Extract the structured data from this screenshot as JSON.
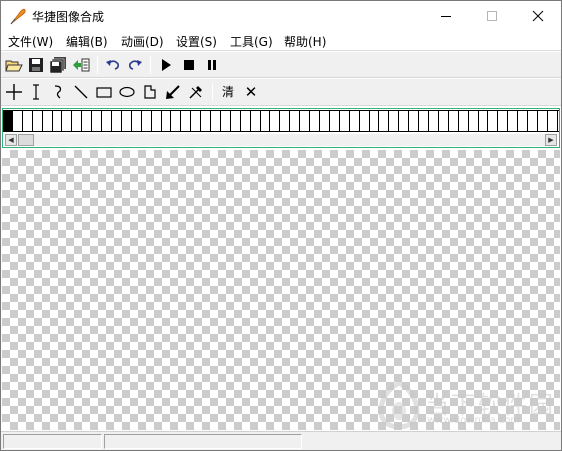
{
  "window": {
    "title": "华捷图像合成",
    "controls": {
      "minimize": "minimize",
      "maximize": "maximize",
      "close": "close"
    }
  },
  "menu": [
    {
      "label": "文件(W)"
    },
    {
      "label": "编辑(B)"
    },
    {
      "label": "动画(D)"
    },
    {
      "label": "设置(S)"
    },
    {
      "label": "工具(G)"
    },
    {
      "label": "帮助(H)"
    }
  ],
  "toolbar1": [
    {
      "name": "open-icon"
    },
    {
      "name": "save-icon"
    },
    {
      "name": "save-all-icon"
    },
    {
      "name": "import-icon"
    },
    {
      "name": "undo-icon"
    },
    {
      "name": "redo-icon"
    },
    {
      "name": "play-icon"
    },
    {
      "name": "stop-icon"
    },
    {
      "name": "pause-icon"
    }
  ],
  "toolbar2": {
    "tools": [
      {
        "name": "crosshair-icon"
      },
      {
        "name": "text-cursor-icon"
      },
      {
        "name": "freehand-icon"
      },
      {
        "name": "line-icon"
      },
      {
        "name": "rectangle-icon"
      },
      {
        "name": "ellipse-icon"
      },
      {
        "name": "polygon-icon"
      },
      {
        "name": "arrow-icon"
      },
      {
        "name": "eyedropper-icon"
      }
    ],
    "clear_label": "清",
    "delete_label": "✕"
  },
  "frame_strip": {
    "frame_count": 56,
    "selected_index": 0
  },
  "watermark": {
    "title": "当下软件园",
    "url": "www.downxia.com"
  },
  "status": {
    "pane1": "",
    "pane2": ""
  },
  "colors": {
    "strip_border": "#2fb27a",
    "checker_dark": "#cccccc",
    "checker_light": "#ffffff"
  }
}
